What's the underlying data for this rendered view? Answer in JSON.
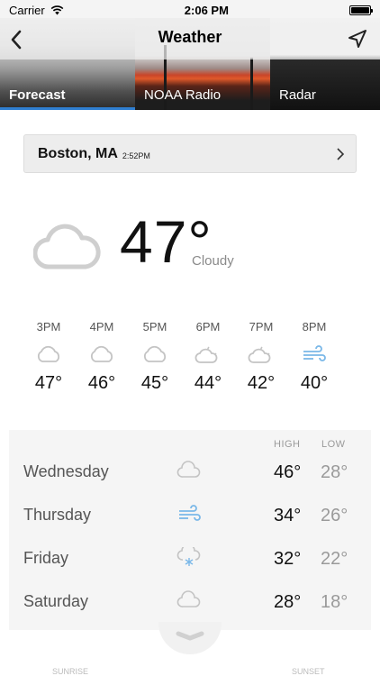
{
  "status_bar": {
    "carrier": "Carrier",
    "time": "2:06 PM"
  },
  "nav": {
    "title": "Weather"
  },
  "tabs": [
    {
      "label": "Forecast",
      "active": true
    },
    {
      "label": "NOAA Radio",
      "active": false
    },
    {
      "label": "Radar",
      "active": false
    }
  ],
  "location": {
    "city": "Boston, MA",
    "updated": "2:52PM"
  },
  "current": {
    "temp": "47°",
    "condition": "Cloudy",
    "icon": "cloud-icon"
  },
  "hourly": [
    {
      "time": "3PM",
      "temp": "47°",
      "icon": "cloud-icon"
    },
    {
      "time": "4PM",
      "temp": "46°",
      "icon": "cloud-icon"
    },
    {
      "time": "5PM",
      "temp": "45°",
      "icon": "cloud-icon"
    },
    {
      "time": "6PM",
      "temp": "44°",
      "icon": "partly-cloudy-night-icon"
    },
    {
      "time": "7PM",
      "temp": "42°",
      "icon": "partly-cloudy-night-icon"
    },
    {
      "time": "8PM",
      "temp": "40°",
      "icon": "wind-icon"
    }
  ],
  "daily": {
    "high_label": "HIGH",
    "low_label": "LOW",
    "days": [
      {
        "day": "Wednesday",
        "high": "46°",
        "low": "28°",
        "icon": "cloud-icon"
      },
      {
        "day": "Thursday",
        "high": "34°",
        "low": "26°",
        "icon": "wind-icon"
      },
      {
        "day": "Friday",
        "high": "32°",
        "low": "22°",
        "icon": "snow-icon"
      },
      {
        "day": "Saturday",
        "high": "28°",
        "low": "18°",
        "icon": "cloud-icon"
      }
    ]
  },
  "sun": {
    "sunrise_label": "SUNRISE",
    "sunset_label": "SUNSET"
  },
  "colors": {
    "accent": "#2f7fd1",
    "icon_gray": "#c4c4c4",
    "wind_blue": "#7ab8e8"
  }
}
